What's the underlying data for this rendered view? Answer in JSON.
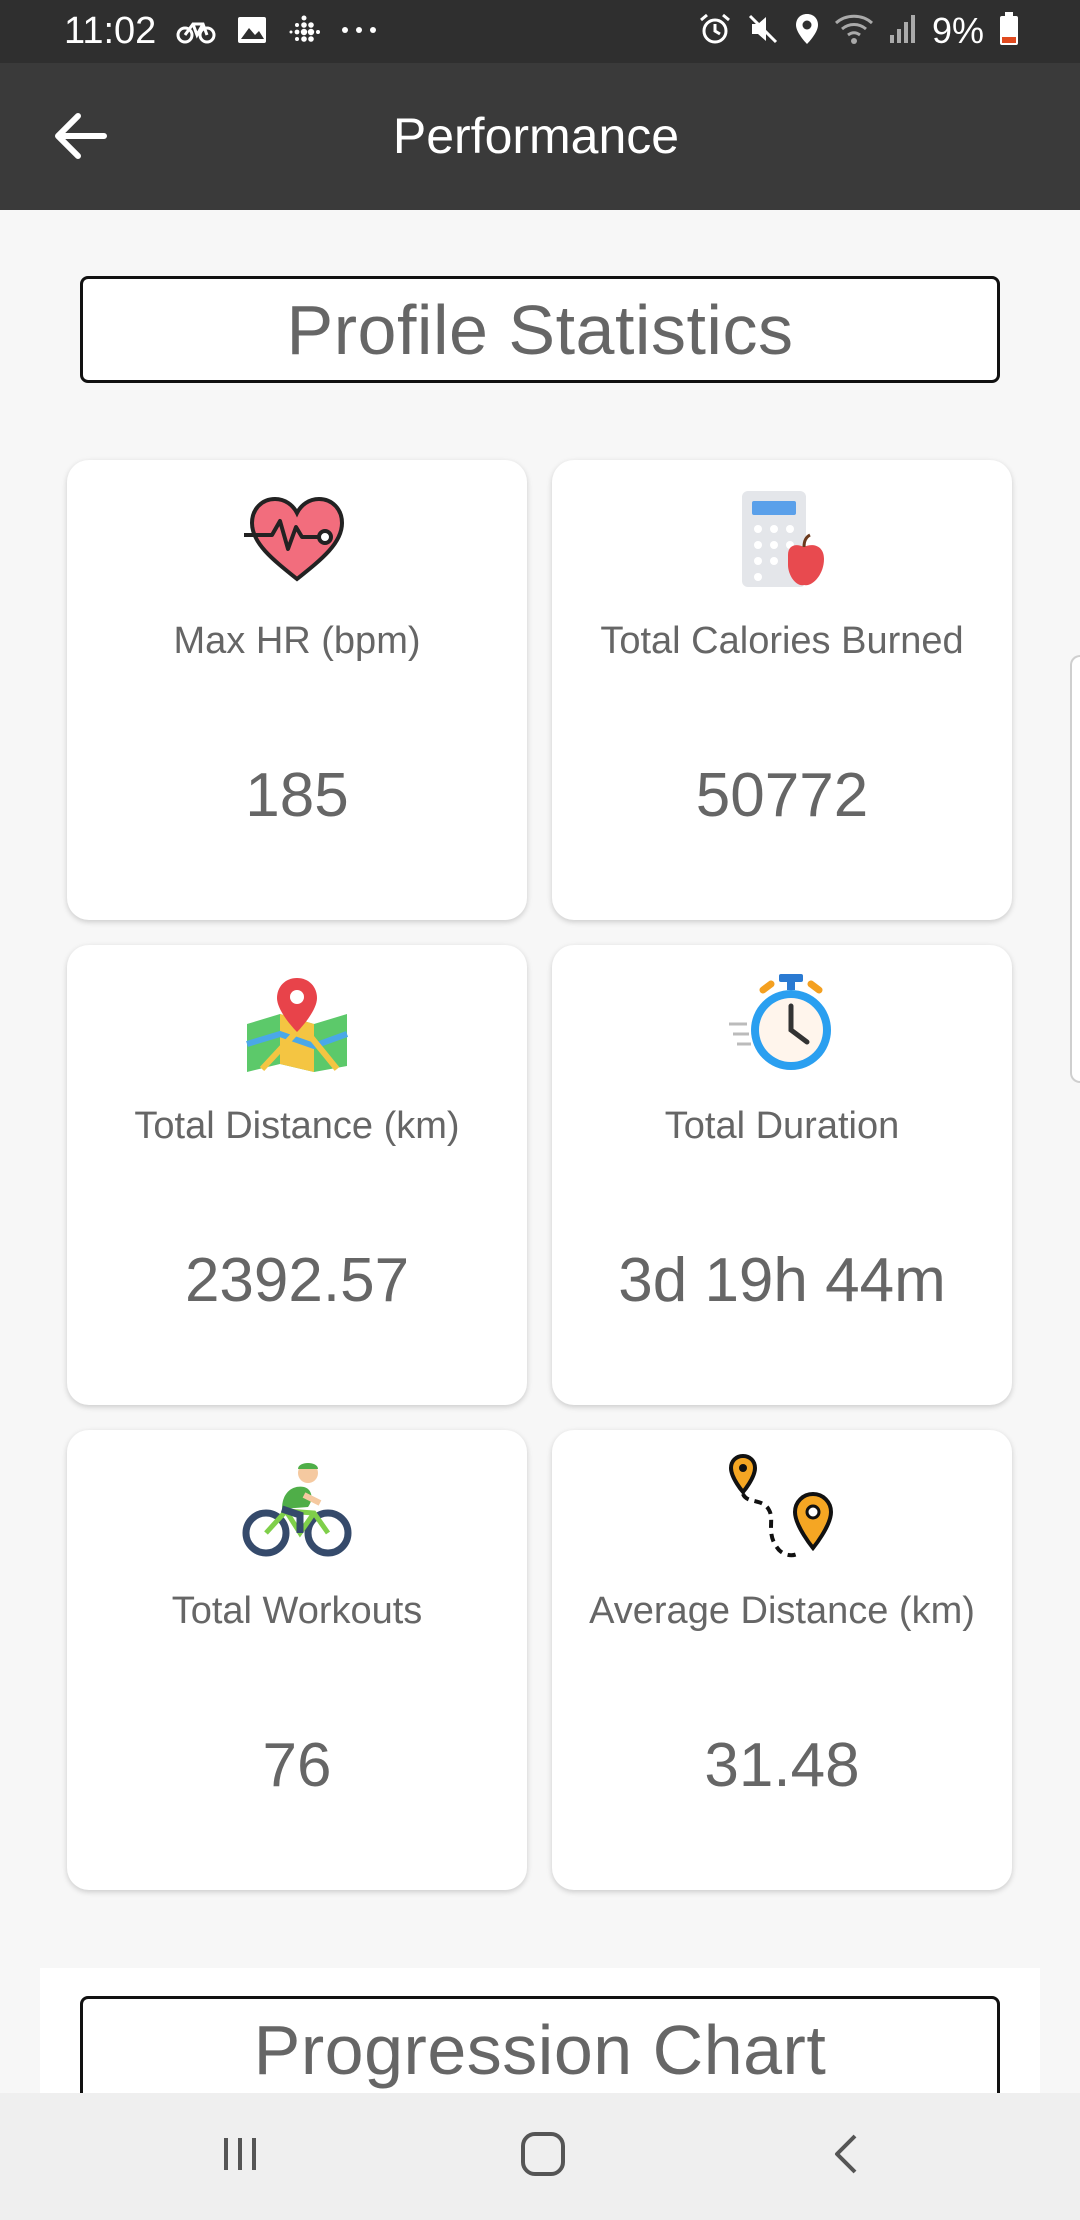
{
  "status_bar": {
    "time": "11:02",
    "battery": "9%",
    "left_icons": [
      "bike-icon",
      "image-icon",
      "fitbit-icon",
      "more-dots-icon"
    ],
    "right_icons": [
      "alarm-icon",
      "mute-icon",
      "location-icon",
      "wifi-icon",
      "signal-icon",
      "battery-icon"
    ]
  },
  "app_bar": {
    "title": "Performance",
    "back_icon": "arrow-left-icon"
  },
  "profile_section": {
    "title": "Profile Statistics"
  },
  "stats": [
    {
      "icon": "heart-rate-icon",
      "label": "Max HR (bpm)",
      "value": "185"
    },
    {
      "icon": "calorie-calculator-icon",
      "label": "Total Calories Burned",
      "value": "50772"
    },
    {
      "icon": "map-pin-icon",
      "label": "Total Distance (km)",
      "value": "2392.57"
    },
    {
      "icon": "stopwatch-icon",
      "label": "Total Duration",
      "value": "3d 19h 44m"
    },
    {
      "icon": "cyclist-icon",
      "label": "Total Workouts",
      "value": "76"
    },
    {
      "icon": "route-icon",
      "label": "Average Distance (km)",
      "value": "31.48"
    }
  ],
  "chart_section": {
    "title": "Progression Chart"
  },
  "nav_bar": {
    "items": [
      "recent-apps-icon",
      "home-icon",
      "back-icon"
    ]
  },
  "colors": {
    "status_bar": "#2f2f2f",
    "app_bar": "#3a3a3a",
    "background": "#f7f7f7",
    "text_gray": "#666666"
  }
}
